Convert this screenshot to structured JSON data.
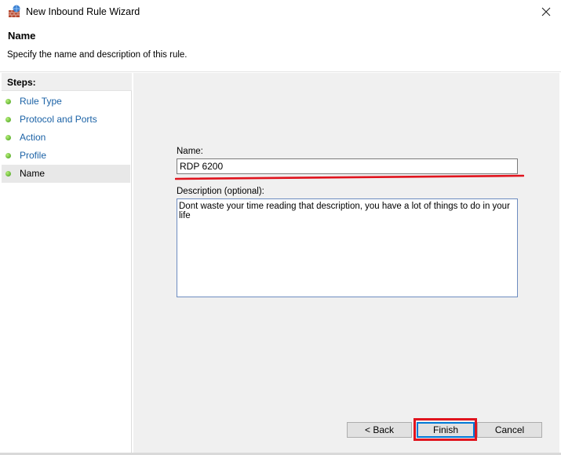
{
  "window": {
    "title": "New Inbound Rule Wizard",
    "icon": "firewall-icon",
    "close_icon": "close-icon"
  },
  "header": {
    "title": "Name",
    "subtitle": "Specify the name and description of this rule."
  },
  "steps": {
    "heading": "Steps:",
    "items": [
      {
        "label": "Rule Type",
        "active": false
      },
      {
        "label": "Protocol and Ports",
        "active": false
      },
      {
        "label": "Action",
        "active": false
      },
      {
        "label": "Profile",
        "active": false
      },
      {
        "label": "Name",
        "active": true
      }
    ]
  },
  "form": {
    "name_label": "Name:",
    "name_value": "RDP 6200",
    "description_label": "Description (optional):",
    "description_value": "Dont waste your time reading that description, you have a lot of things to do in your life"
  },
  "buttons": {
    "back": "< Back",
    "finish": "Finish",
    "cancel": "Cancel"
  },
  "colors": {
    "annotation_red": "#e0141e",
    "step_link": "#1b62a6",
    "focus_blue": "#0078d7"
  }
}
